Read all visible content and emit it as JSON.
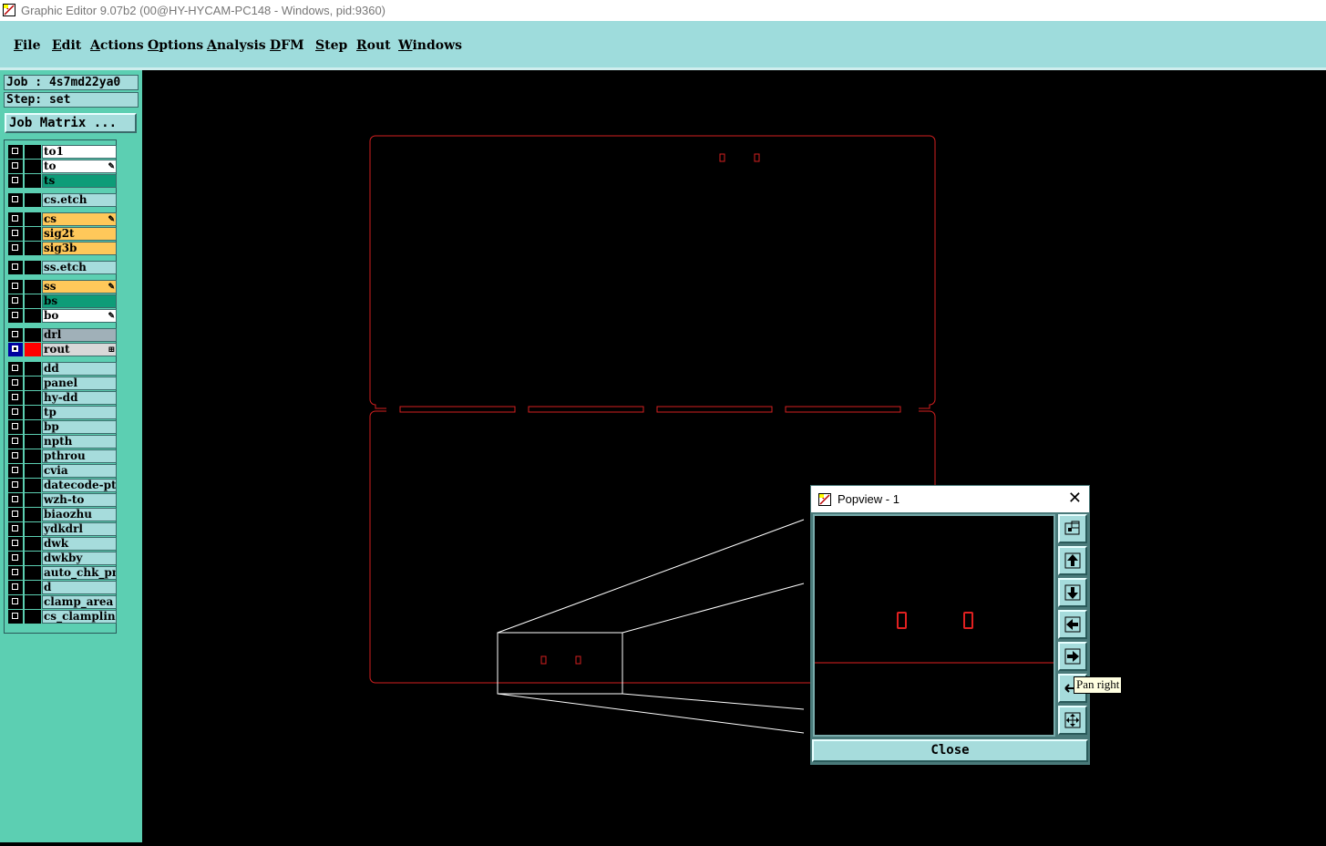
{
  "window": {
    "title": "Graphic Editor 9.07b2 (00@HY-HYCAM-PC148 - Windows, pid:9360)"
  },
  "menu": [
    {
      "label": "File",
      "u": "F",
      "rest": "ile"
    },
    {
      "label": "Edit",
      "u": "E",
      "rest": "dit"
    },
    {
      "label": "Actions",
      "u": "A",
      "rest": "ctions"
    },
    {
      "label": "Options",
      "u": "O",
      "rest": "ptions"
    },
    {
      "label": "Analysis",
      "u": "A",
      "rest": "nalysis"
    },
    {
      "label": "DFM",
      "u": "D",
      "rest": "FM"
    },
    {
      "label": "Step",
      "u": "S",
      "rest": "tep"
    },
    {
      "label": "Rout",
      "u": "R",
      "rest": "out"
    },
    {
      "label": "Windows",
      "u": "W",
      "rest": "indows"
    }
  ],
  "job": {
    "line": "Job : 4s7md22ya0",
    "step": "Step: set"
  },
  "job_matrix_label": "Job Matrix ...",
  "layers": [
    {
      "name": "to1",
      "color": "#ffffff",
      "mark": ""
    },
    {
      "name": "to",
      "color": "#ffffff",
      "mark": "✎"
    },
    {
      "name": "ts",
      "color": "#0e9c78",
      "mark": ""
    },
    {
      "name": "cs.etch",
      "color": "#a6dcdc",
      "mark": ""
    },
    {
      "name": "cs",
      "color": "#ffc85a",
      "mark": "✎"
    },
    {
      "name": "sig2t",
      "color": "#ffc85a",
      "mark": ""
    },
    {
      "name": "sig3b",
      "color": "#ffc85a",
      "mark": ""
    },
    {
      "name": "ss.etch",
      "color": "#a6dcdc",
      "mark": ""
    },
    {
      "name": "ss",
      "color": "#ffc85a",
      "mark": "✎"
    },
    {
      "name": "bs",
      "color": "#0e9c78",
      "mark": ""
    },
    {
      "name": "bo",
      "color": "#ffffff",
      "mark": "✎"
    },
    {
      "name": "drl",
      "color": "#a0b0b8",
      "mark": ""
    },
    {
      "name": "rout",
      "color": "#d8d8d8",
      "mark": "⊞",
      "selected": true,
      "swatch": "#ff0000"
    },
    {
      "name": "dd",
      "color": "#a6dcdc",
      "mark": ""
    },
    {
      "name": "panel",
      "color": "#a6dcdc",
      "mark": ""
    },
    {
      "name": "hy-dd",
      "color": "#a6dcdc",
      "mark": ""
    },
    {
      "name": "tp",
      "color": "#a6dcdc",
      "mark": ""
    },
    {
      "name": "bp",
      "color": "#a6dcdc",
      "mark": ""
    },
    {
      "name": "npth",
      "color": "#a6dcdc",
      "mark": ""
    },
    {
      "name": "pthrou",
      "color": "#a6dcdc",
      "mark": ""
    },
    {
      "name": "cvia",
      "color": "#a6dcdc",
      "mark": ""
    },
    {
      "name": "datecode-pte",
      "color": "#a6dcdc",
      "mark": ""
    },
    {
      "name": "wzh-to",
      "color": "#a6dcdc",
      "mark": ""
    },
    {
      "name": "biaozhu",
      "color": "#a6dcdc",
      "mark": ""
    },
    {
      "name": "ydkdrl",
      "color": "#a6dcdc",
      "mark": ""
    },
    {
      "name": "dwk",
      "color": "#a6dcdc",
      "mark": ""
    },
    {
      "name": "dwkby",
      "color": "#a6dcdc",
      "mark": ""
    },
    {
      "name": "auto_chk_pnl",
      "color": "#a6dcdc",
      "mark": ""
    },
    {
      "name": "d",
      "color": "#a6dcdc",
      "mark": ""
    },
    {
      "name": "clamp_area",
      "color": "#a6dcdc",
      "mark": ""
    },
    {
      "name": "cs_clampline",
      "color": "#a6dcdc",
      "mark": ""
    }
  ],
  "popview": {
    "title": "Popview - 1",
    "close_label": "Close"
  },
  "tooltip": "Pan right",
  "colors": {
    "rout_line": "#ff2020",
    "menu_bg": "#9edcdc",
    "panel_bg": "#5ccfb2"
  }
}
